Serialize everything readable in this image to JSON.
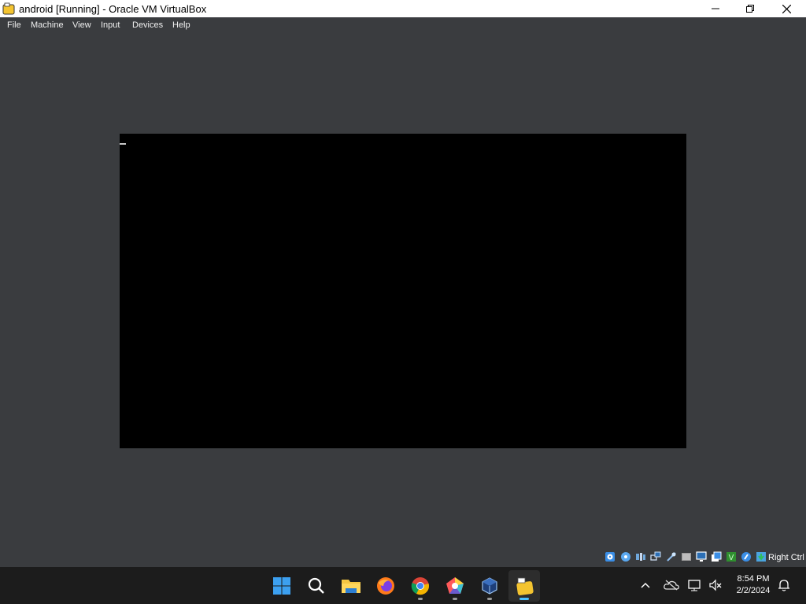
{
  "window": {
    "title": "android [Running] - Oracle VM VirtualBox",
    "icon": "virtualbox-app-icon",
    "controls": [
      "minimize-icon",
      "restore-icon",
      "close-icon"
    ]
  },
  "menu": {
    "items": [
      "File",
      "Machine",
      "View",
      "Input",
      "Devices",
      "Help"
    ]
  },
  "vm": {
    "screen_state": "black console with text cursor"
  },
  "statusbar": {
    "icons": [
      "hard-disk-icon",
      "optical-drive-icon",
      "audio-icon",
      "network-icon",
      "usb-icon",
      "shared-folders-icon",
      "display-icon",
      "video-capture-icon",
      "cpu-icon",
      "mouse-integration-icon",
      "keyboard-capture-icon"
    ],
    "host_key": "Right Ctrl"
  },
  "taskbar": {
    "apps": [
      "windows-start-icon",
      "search-icon",
      "file-explorer-icon",
      "firefox-icon",
      "chrome-icon",
      "pentagon-app-icon",
      "virtualbox-manager-icon",
      "virtualbox-vm-icon"
    ],
    "tray": [
      "show-hidden-icons-chevron",
      "cloud-offline-icon",
      "network-icon",
      "volume-muted-icon",
      "notifications-bell-icon"
    ],
    "clock_time": "8:54 PM",
    "clock_date": "2/2/2024"
  },
  "colors": {
    "background": "#3a3c3f",
    "titlebar": "#ffffff",
    "taskbar": "#1c1c1c",
    "vm_screen": "#000000",
    "accent": "#4cc2ff"
  }
}
